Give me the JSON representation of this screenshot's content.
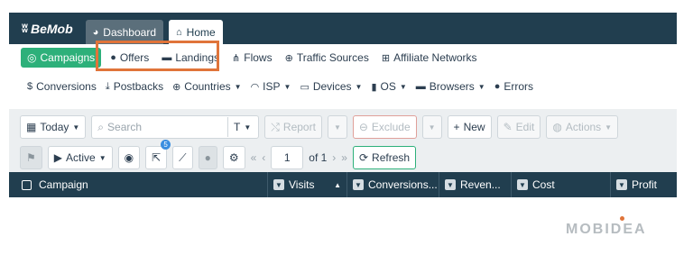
{
  "app": {
    "logo": "BeMob"
  },
  "top_tabs": [
    {
      "label": "Dashboard",
      "icon": "dashboard-icon"
    },
    {
      "label": "Home",
      "icon": "home-icon"
    }
  ],
  "nav": {
    "campaigns": "Campaigns",
    "offers": "Offers",
    "landings": "Landings",
    "flows": "Flows",
    "traffic_sources": "Traffic Sources",
    "affiliate_networks": "Affiliate Networks"
  },
  "reports": {
    "conversions": "Conversions",
    "postbacks": "Postbacks",
    "countries": "Countries",
    "isp": "ISP",
    "devices": "Devices",
    "os": "OS",
    "browsers": "Browsers",
    "errors": "Errors"
  },
  "toolbar": {
    "date_range": "Today",
    "search_placeholder": "Search",
    "search_type": "T",
    "report": "Report",
    "exclude": "Exclude",
    "new": "New",
    "edit": "Edit",
    "actions": "Actions",
    "status": "Active",
    "notify_badge": "5",
    "page": "1",
    "of_pages": "of 1",
    "refresh": "Refresh"
  },
  "table": {
    "columns": [
      "Campaign",
      "Visits",
      "Conversions...",
      "Reven...",
      "Cost",
      "Profit"
    ]
  },
  "watermark": "MOBIDEA"
}
